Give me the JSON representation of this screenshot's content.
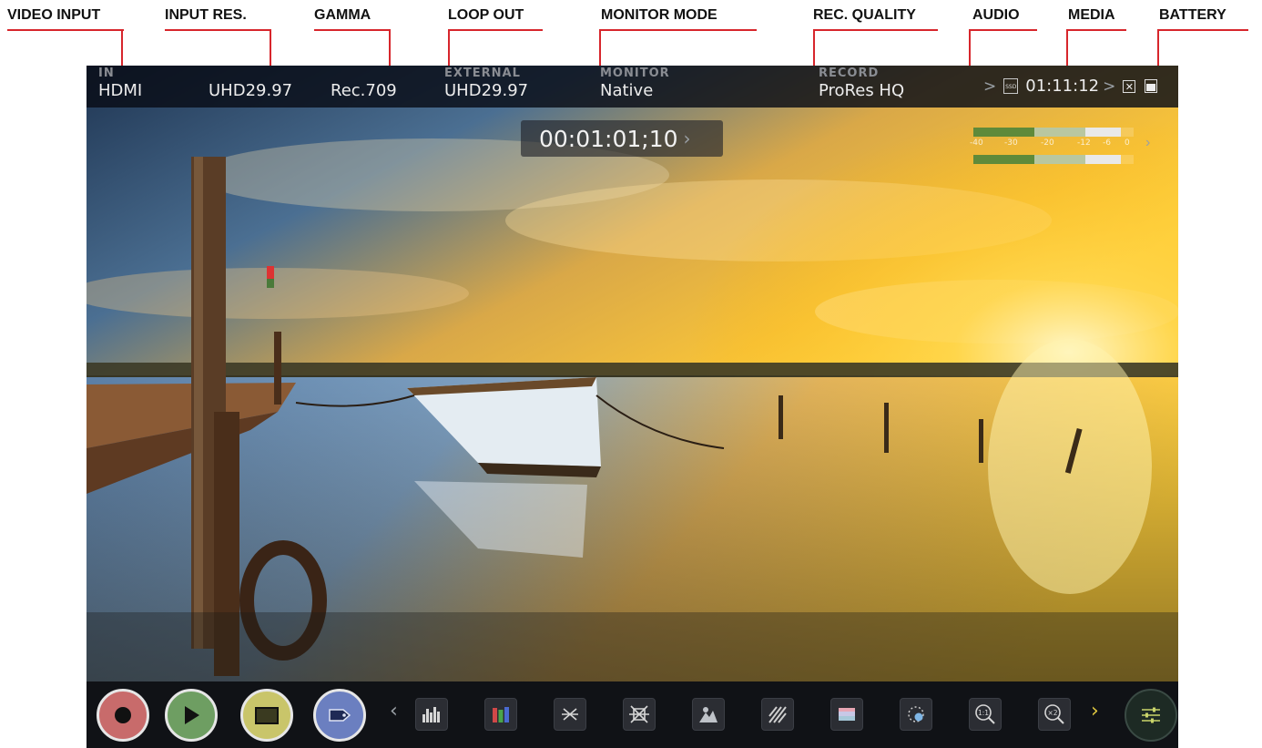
{
  "callouts": [
    {
      "id": "video_input",
      "label": "VIDEO INPUT"
    },
    {
      "id": "input_res",
      "label": "INPUT RES."
    },
    {
      "id": "gamma",
      "label": "GAMMA"
    },
    {
      "id": "loop_out",
      "label": "LOOP OUT"
    },
    {
      "id": "monitor_mode",
      "label": "MONITOR MODE"
    },
    {
      "id": "rec_quality",
      "label": "REC. QUALITY"
    },
    {
      "id": "audio",
      "label": "AUDIO"
    },
    {
      "id": "media",
      "label": "MEDIA"
    },
    {
      "id": "battery",
      "label": "BATTERY"
    }
  ],
  "status_bar": {
    "input": {
      "header": "IN",
      "value": "HDMI"
    },
    "resolution": {
      "value": "UHD29.97"
    },
    "gamma": {
      "value": "Rec.709"
    },
    "external": {
      "header": "EXTERNAL",
      "value": "UHD29.97"
    },
    "monitor": {
      "header": "MONITOR",
      "value": "Native"
    },
    "record": {
      "header": "RECORD",
      "value": "ProRes HQ"
    },
    "media": {
      "chevron": ">",
      "media_label": "SSD",
      "time_remaining": "01:11:12",
      "chevron2": ">"
    },
    "battery": {
      "disconnect_symbol": "✕"
    }
  },
  "timecode": {
    "value": "00:01:01;10",
    "chevron": "›"
  },
  "audio_meter": {
    "scale": [
      "-40",
      "-30",
      "-20",
      "-12",
      "-6",
      "0"
    ],
    "chevron": "›",
    "channels": [
      {
        "name": "ch1",
        "level": 0.92
      },
      {
        "name": "ch2",
        "level": 0.92
      }
    ],
    "colors": {
      "low": "#5f8a3a",
      "mid": "#b9c7a0",
      "high": "#e9e9e9"
    }
  },
  "toolbar": {
    "prev_chevron": "‹",
    "next_chevron": "›",
    "main_buttons": [
      {
        "id": "record",
        "color": "#c86b6b"
      },
      {
        "id": "play",
        "color": "#6e9e62"
      },
      {
        "id": "monitor",
        "color": "#c9c56a"
      },
      {
        "id": "tag",
        "color": "#6b7fc0"
      }
    ],
    "tools": [
      {
        "id": "histogram",
        "icon": "histogram-icon"
      },
      {
        "id": "rgb-parade",
        "icon": "rgb-parade-icon"
      },
      {
        "id": "vectorscope",
        "icon": "vectorscope-icon"
      },
      {
        "id": "vectorscope-zoom",
        "icon": "vectorscope-large-icon"
      },
      {
        "id": "false-color",
        "icon": "false-color-icon"
      },
      {
        "id": "zebra",
        "icon": "zebra-icon"
      },
      {
        "id": "lut",
        "icon": "lut-icon"
      },
      {
        "id": "focus-peaking",
        "icon": "focus-peaking-icon"
      },
      {
        "id": "zoom-1to1",
        "icon": "zoom-1to1-icon",
        "text": "1:1"
      },
      {
        "id": "zoom-2x",
        "icon": "zoom-2x-icon",
        "text": "×2"
      }
    ],
    "settings": {
      "icon": "settings-sliders-icon"
    }
  }
}
